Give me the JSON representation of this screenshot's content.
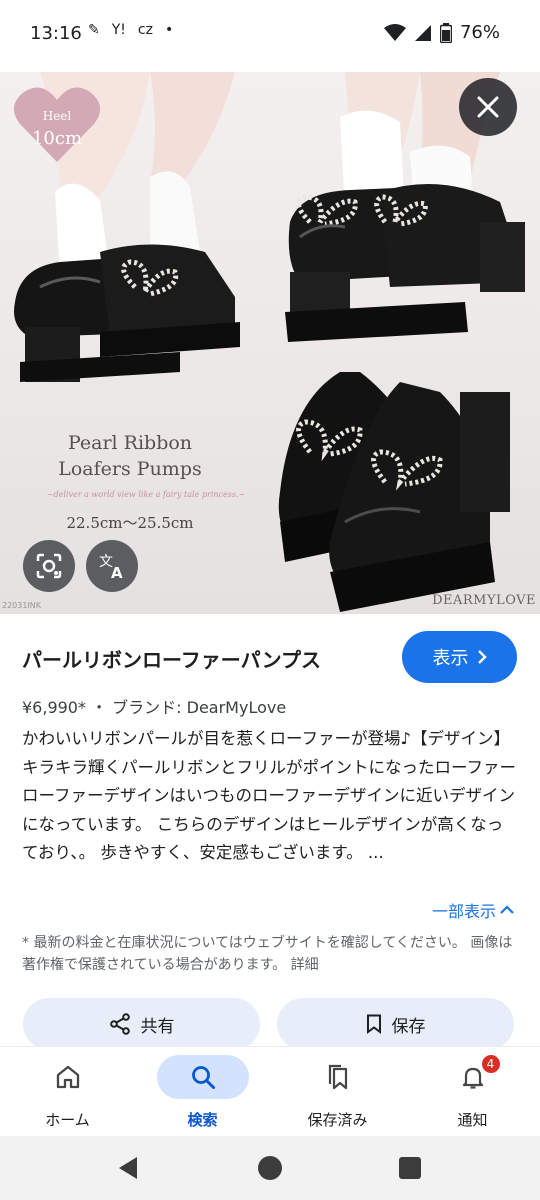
{
  "status": {
    "time": "13:16",
    "left_icons": [
      "✎",
      "Y!",
      "cz",
      "•"
    ],
    "battery": "76%"
  },
  "image": {
    "heel_badge_line1": "Heel",
    "heel_badge_line2": "10cm",
    "promo_title_line1": "Pearl Ribbon",
    "promo_title_line2": "Loafers Pumps",
    "promo_tagline": "~deliver a world view like a fairy tale princess.~",
    "promo_sizes": "22.5cm～25.5cm",
    "brand_watermark": "DEARMYLOVE",
    "code": "22031INK"
  },
  "product": {
    "title": "パールリボンローファーパンプス",
    "view_button": "表示",
    "meta": "¥6,990* ・ ブランド: DearMyLove",
    "description": "かわいいリボンパールが目を惹くローファーが登場♪【デザイン】 キラキラ輝くパールリボンとフリルがポイントになったローファー ローファーデザインはいつものローファーデザインに近いデザインになっています。 こちらのデザインはヒールデザインが高くなっており、。 歩きやすく、安定感もございます。 ...",
    "show_less": "一部表示",
    "disclaimer": "* 最新の料金と在庫状況についてはウェブサイトを確認してください。 画像は著作権で保護されている場合があります。 詳細"
  },
  "actions": {
    "share": "共有",
    "save": "保存"
  },
  "nav": {
    "items": [
      {
        "label": "ホーム",
        "icon": "home-icon"
      },
      {
        "label": "検索",
        "icon": "search-icon"
      },
      {
        "label": "保存済み",
        "icon": "saved-icon"
      },
      {
        "label": "通知",
        "icon": "bell-icon"
      }
    ],
    "notification_count": "4"
  },
  "colors": {
    "accent": "#1a73e8",
    "active_pill": "#d3e3fd",
    "badge": "#d93025"
  }
}
